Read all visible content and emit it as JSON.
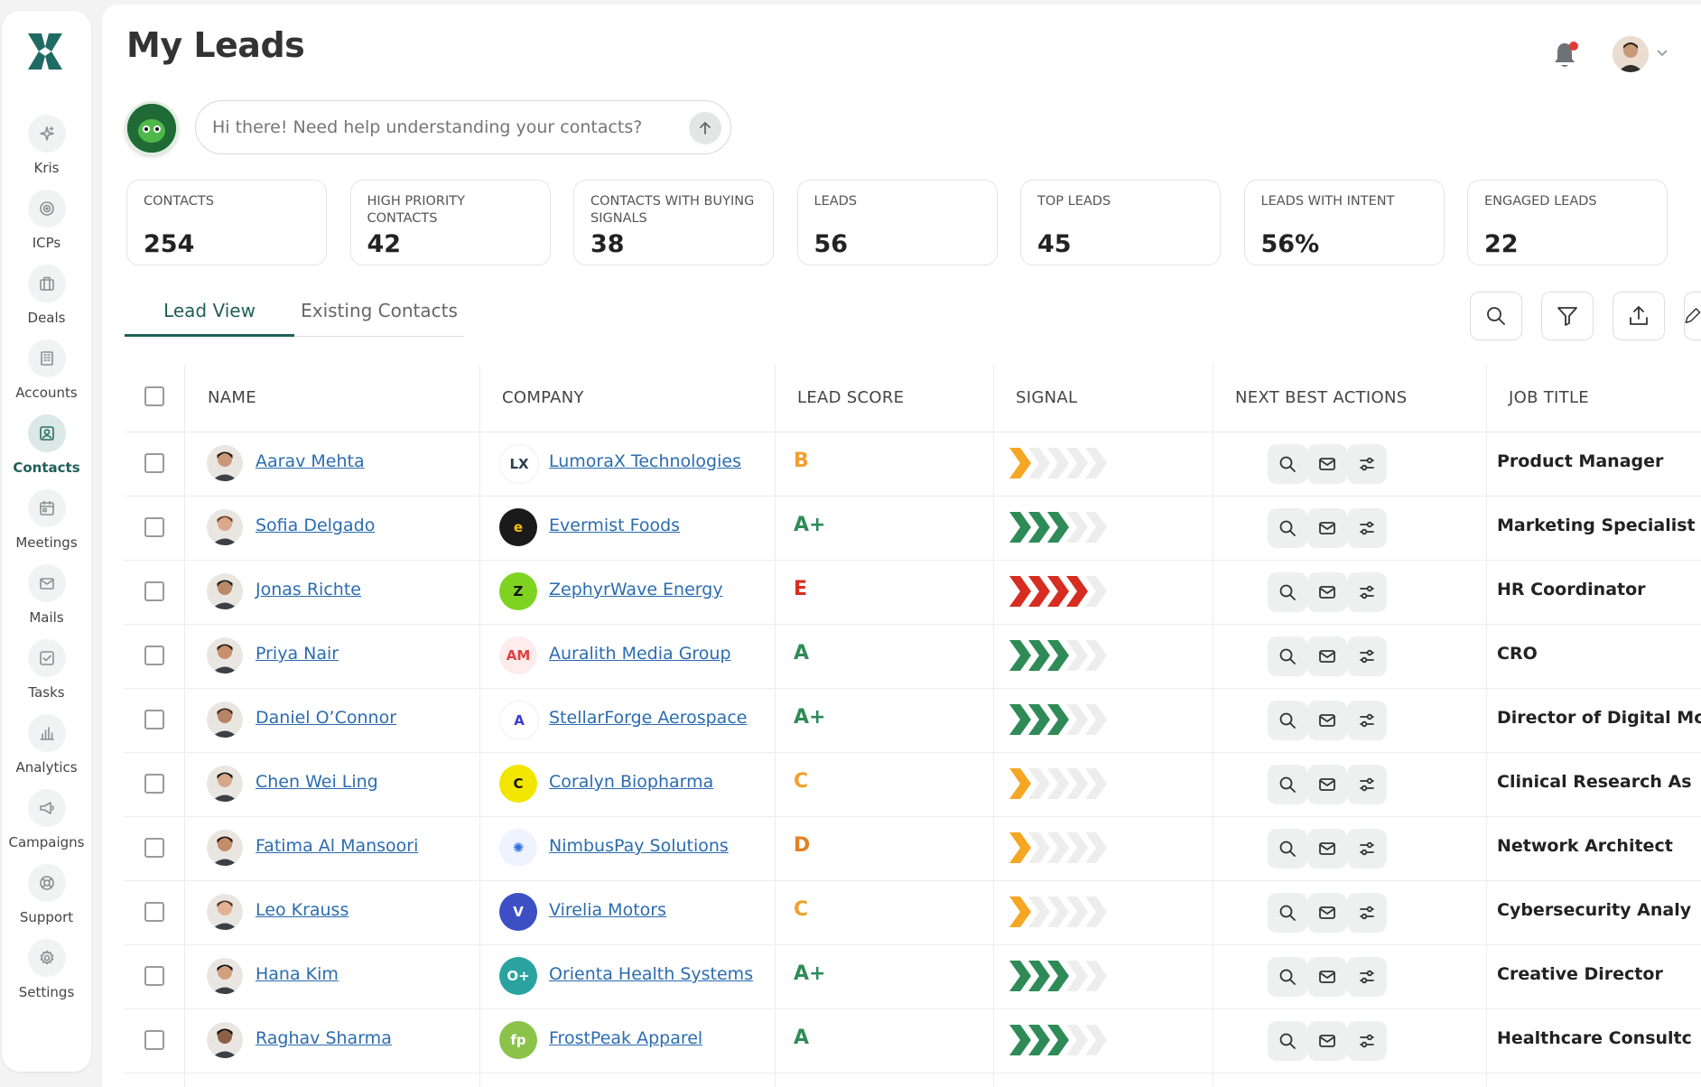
{
  "page": {
    "title": "My Leads"
  },
  "sidebar": {
    "items": [
      {
        "label": "Kris",
        "icon": "sparkle-icon"
      },
      {
        "label": "ICPs",
        "icon": "target-icon"
      },
      {
        "label": "Deals",
        "icon": "briefcase-icon"
      },
      {
        "label": "Accounts",
        "icon": "building-icon"
      },
      {
        "label": "Contacts",
        "icon": "contact-card-icon",
        "active": true
      },
      {
        "label": "Meetings",
        "icon": "calendar-icon"
      },
      {
        "label": "Mails",
        "icon": "mail-icon"
      },
      {
        "label": "Tasks",
        "icon": "checkbox-icon"
      },
      {
        "label": "Analytics",
        "icon": "bar-chart-icon"
      },
      {
        "label": "Campaigns",
        "icon": "megaphone-icon"
      },
      {
        "label": "Support",
        "icon": "lifebuoy-icon"
      },
      {
        "label": "Settings",
        "icon": "gear-icon"
      }
    ]
  },
  "assistant": {
    "placeholder": "Hi there! Need help understanding your contacts?"
  },
  "stats": [
    {
      "label": "CONTACTS",
      "value": "254"
    },
    {
      "label": "HIGH PRIORITY CONTACTS",
      "value": "42"
    },
    {
      "label": "CONTACTS WITH BUYING SIGNALS",
      "value": "38"
    },
    {
      "label": "LEADS",
      "value": "56"
    },
    {
      "label": "TOP LEADS",
      "value": "45"
    },
    {
      "label": "LEADS WITH INTENT",
      "value": "56%"
    },
    {
      "label": "ENGAGED LEADS",
      "value": "22"
    }
  ],
  "tabs": {
    "lead_view": "Lead View",
    "existing_contacts": "Existing Contacts"
  },
  "table": {
    "headers": {
      "name": "NAME",
      "company": "COMPANY",
      "lead_score": "LEAD SCORE",
      "signal": "SIGNAL",
      "next_best_actions": "NEXT BEST ACTIONS",
      "job_title": "JOB TITLE"
    },
    "rows": [
      {
        "name": "Aarav Mehta",
        "company": "LumoraX Technologies",
        "score": "B",
        "signal_level": 1,
        "signal_color": "#f5a623",
        "job": "Product Manager",
        "logo_text": "LX",
        "logo_bg": "#ffffff",
        "logo_fg": "#2c3e50",
        "score_color": "#f0a030"
      },
      {
        "name": "Sofia Delgado",
        "company": "Evermist Foods",
        "score": "A+",
        "signal_level": 3,
        "signal_color": "#2e8b57",
        "job": "Marketing Specialist",
        "logo_text": "e",
        "logo_bg": "#1a1a1a",
        "logo_fg": "#f5c000",
        "score_color": "#2e8b57"
      },
      {
        "name": "Jonas Richte",
        "company": "ZephyrWave Energy",
        "score": "E",
        "signal_level": 4,
        "signal_color": "#d62d20",
        "job": "HR Coordinator",
        "logo_text": "Z",
        "logo_bg": "#7ed321",
        "logo_fg": "#111111",
        "score_color": "#d62d20"
      },
      {
        "name": "Priya Nair",
        "company": "Auralith Media Group",
        "score": "A",
        "signal_level": 3,
        "signal_color": "#2e8b57",
        "job": "CRO",
        "logo_text": "AM",
        "logo_bg": "#fdecec",
        "logo_fg": "#e04040",
        "score_color": "#2e8b57"
      },
      {
        "name": "Daniel O’Connor",
        "company": "StellarForge Aerospace",
        "score": "A+",
        "signal_level": 3,
        "signal_color": "#2e8b57",
        "job": "Director of Digital Mc",
        "logo_text": "A",
        "logo_bg": "#ffffff",
        "logo_fg": "#3a3ad0",
        "score_color": "#2e8b57"
      },
      {
        "name": "Chen Wei Ling",
        "company": "Coralyn Biopharma",
        "score": "C",
        "signal_level": 1,
        "signal_color": "#f5a623",
        "job": "Clinical Research As",
        "logo_text": "C",
        "logo_bg": "#f2e600",
        "logo_fg": "#111111",
        "score_color": "#f0a030"
      },
      {
        "name": "Fatima Al Mansoori",
        "company": "NimbusPay Solutions",
        "score": "D",
        "signal_level": 1,
        "signal_color": "#f5a623",
        "job": "Network Architect",
        "logo_text": "✺",
        "logo_bg": "#eef3ff",
        "logo_fg": "#2f6be0",
        "score_color": "#e67e22"
      },
      {
        "name": "Leo Krauss",
        "company": "Virelia Motors",
        "score": "C",
        "signal_level": 1,
        "signal_color": "#f5a623",
        "job": "Cybersecurity Analy",
        "logo_text": "V",
        "logo_bg": "#3d4fc4",
        "logo_fg": "#ffffff",
        "score_color": "#f0a030"
      },
      {
        "name": "Hana Kim",
        "company": "Orienta Health Systems",
        "score": "A+",
        "signal_level": 3,
        "signal_color": "#2e8b57",
        "job": "Creative Director",
        "logo_text": "O+",
        "logo_bg": "#2aa3a0",
        "logo_fg": "#ffffff",
        "score_color": "#2e8b57"
      },
      {
        "name": "Raghav Sharma",
        "company": "FrostPeak Apparel",
        "score": "A",
        "signal_level": 3,
        "signal_color": "#2e8b57",
        "job": "Healthcare Consultc",
        "logo_text": "fp",
        "logo_bg": "#8bc34a",
        "logo_fg": "#ffffff",
        "score_color": "#2e8b57"
      }
    ]
  },
  "colors": {
    "accent": "#1f5f57",
    "link": "#2b6cb0",
    "signal_empty": "#ededed"
  }
}
